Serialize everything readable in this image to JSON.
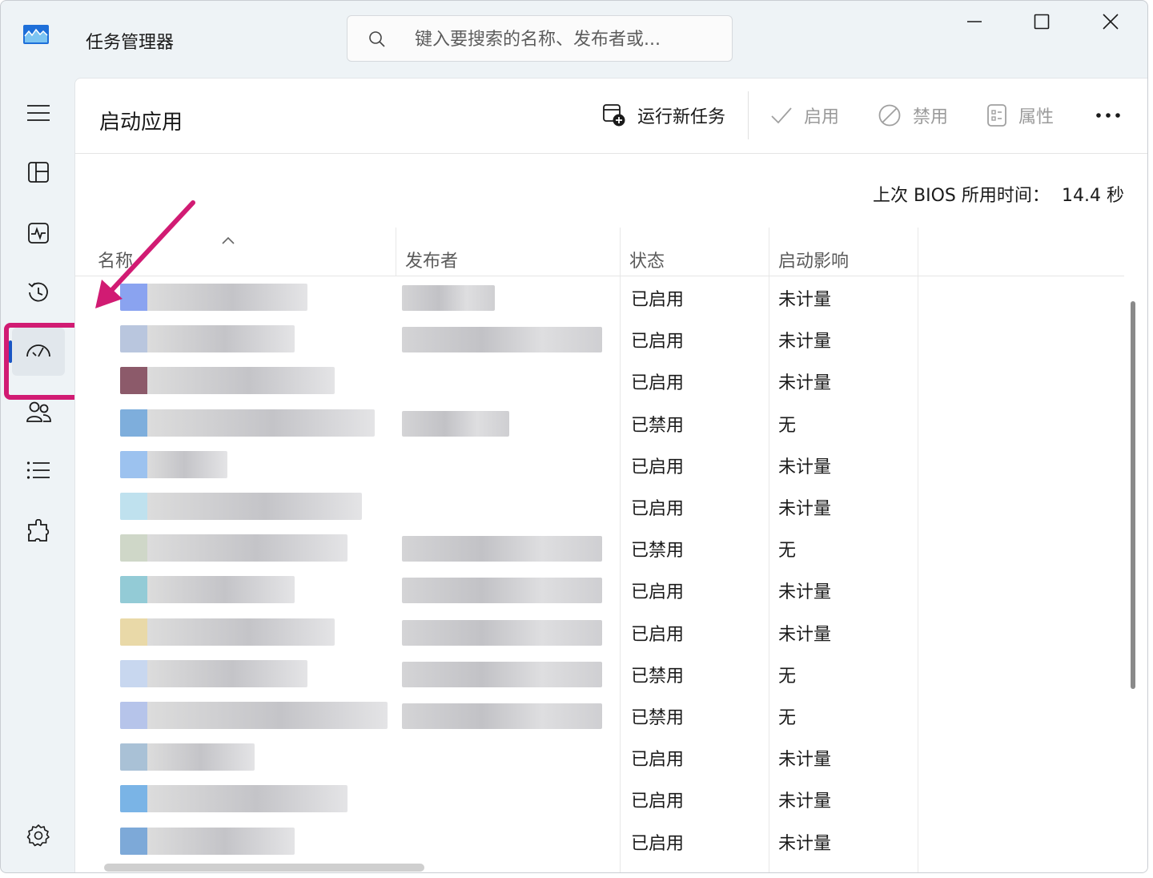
{
  "window": {
    "title": "任务管理器"
  },
  "search": {
    "placeholder": "键入要搜索的名称、发布者或..."
  },
  "nav": {
    "items": [
      {
        "id": "hamburger",
        "icon": "hamburger-menu-icon"
      },
      {
        "id": "processes",
        "icon": "processes-grid-icon"
      },
      {
        "id": "performance",
        "icon": "performance-pulse-icon"
      },
      {
        "id": "app-history",
        "icon": "history-clock-icon"
      },
      {
        "id": "startup-apps",
        "icon": "startup-speedometer-icon",
        "active": true
      },
      {
        "id": "users",
        "icon": "users-icon"
      },
      {
        "id": "details",
        "icon": "details-list-icon"
      },
      {
        "id": "services",
        "icon": "services-puzzle-icon"
      },
      {
        "id": "settings",
        "icon": "settings-gear-icon"
      }
    ]
  },
  "page": {
    "title": "启动应用",
    "toolbar": {
      "run_new_task": "运行新任务",
      "enable": "启用",
      "disable": "禁用",
      "properties": "属性"
    },
    "bios_label": "上次 BIOS 所用时间：",
    "bios_value": "14.4 秒"
  },
  "table": {
    "columns": [
      "名称",
      "发布者",
      "状态",
      "启动影响"
    ],
    "rows": [
      {
        "status": "已启用",
        "impact": "未计量"
      },
      {
        "status": "已启用",
        "impact": "未计量"
      },
      {
        "status": "已启用",
        "impact": "未计量"
      },
      {
        "status": "已禁用",
        "impact": "无"
      },
      {
        "status": "已启用",
        "impact": "未计量"
      },
      {
        "status": "已启用",
        "impact": "未计量"
      },
      {
        "status": "已禁用",
        "impact": "无"
      },
      {
        "status": "已启用",
        "impact": "未计量"
      },
      {
        "status": "已启用",
        "impact": "未计量"
      },
      {
        "status": "已禁用",
        "impact": "无"
      },
      {
        "status": "已禁用",
        "impact": "无"
      },
      {
        "status": "已启用",
        "impact": "未计量"
      },
      {
        "status": "已启用",
        "impact": "未计量"
      },
      {
        "status": "已启用",
        "impact": "未计量"
      }
    ]
  },
  "colors": {
    "accent": "#1a56c4",
    "annotation": "#d11b73"
  }
}
